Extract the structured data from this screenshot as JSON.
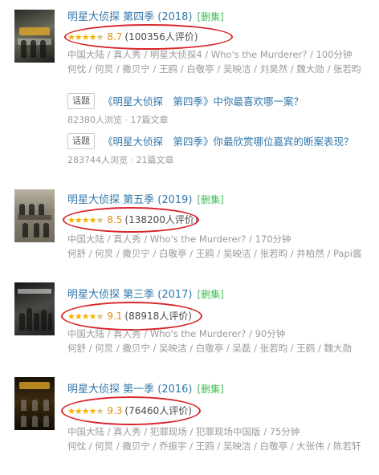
{
  "entries": [
    {
      "title": "明星大侦探 第四季 (2018)",
      "playable": "[删集]",
      "score": "8.7",
      "count": "(100356人评价)",
      "meta_line1": "中国大陆 / 真人秀 / 明星大侦探4 / Who's the Murderer? / 100分钟",
      "meta_line2": "何忱 / 何炅 / 撒贝宁 / 王鸥 / 白敬亭 / 吴映洁 / 刘昊然 / 魏大勋 / 张若昀",
      "topics": [
        {
          "tag": "话题",
          "title": "《明星大侦探　第四季》中你最喜欢哪一案？",
          "stats": "82380人浏览 · 17篇文章"
        },
        {
          "tag": "话题",
          "title": "《明星大侦探　第四季》你最欣赏哪位嘉宾的断案表现？",
          "stats": "283744人浏览 · 21篇文章"
        }
      ]
    },
    {
      "title": "明星大侦探 第五季 (2019)",
      "playable": "[删集]",
      "score": "8.5",
      "count": "(138200人评价)",
      "meta_line1": "中国大陆 / 真人秀 / Who's the Murderer? / 170分钟",
      "meta_line2": "何舒 / 何炅 / 撒贝宁 / 白敬亭 / 王鸥 / 吴映洁 / 张若昀 / 井柏然 / Papi酱"
    },
    {
      "title": "明星大侦探 第三季 (2017)",
      "playable": "[删集]",
      "score": "9.1",
      "count": "(88918人评价)",
      "meta_line1": "中国大陆 / 真人秀 / Who's the Murderer? / 90分钟",
      "meta_line2": "何舒 / 何炅 / 撒贝宁 / 吴映洁 / 白敬亭 / 吴磊 / 张若昀 / 王鸥 / 魏大勋"
    },
    {
      "title": "明星大侦探 第一季 (2016)",
      "playable": "[删集]",
      "score": "9.3",
      "count": "(76460人评价)",
      "meta_line1": "中国大陆 / 真人秀 / 犯罪现场 / 犯罪现场中国版 / 75分钟",
      "meta_line2": "何忱 / 何炅 / 撒贝宁 / 乔振宇 / 王鸥 / 吴映洁 / 白敬亭 / 大张伟 / 陈若轩"
    }
  ],
  "rating_stars": {
    "first": "★★★★",
    "half": "★"
  },
  "colors": {
    "link": "#3377aa",
    "playable": "#42bd56",
    "star": "#f7b000",
    "score": "#e09015",
    "annotation": "#d9252a"
  }
}
